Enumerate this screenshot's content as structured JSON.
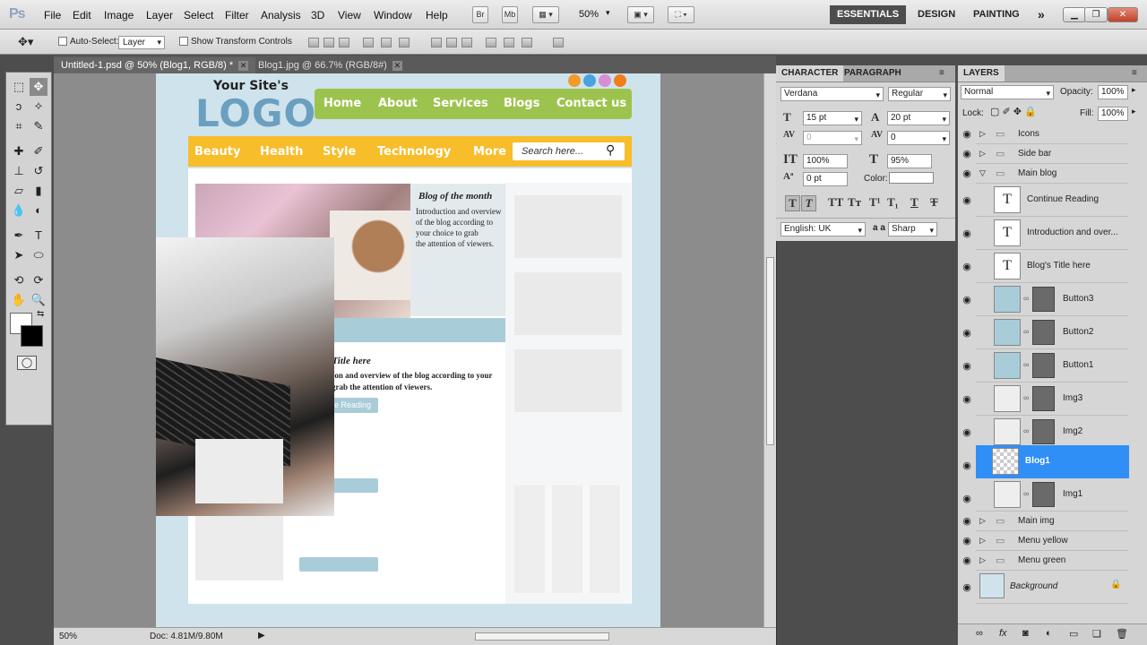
{
  "app": {
    "logo": "Ps"
  },
  "menu": [
    "File",
    "Edit",
    "Image",
    "Layer",
    "Select",
    "Filter",
    "Analysis",
    "3D",
    "View",
    "Window",
    "Help"
  ],
  "top_toolbar": {
    "bridge": "Br",
    "mini_bridge": "Mb",
    "zoom": "50%"
  },
  "workspaces": {
    "essentials": "ESSENTIALS",
    "design": "DESIGN",
    "painting": "PAINTING",
    "more": "»"
  },
  "options": {
    "auto_select": "Auto-Select:",
    "auto_select_value": "Layer",
    "show_transform": "Show Transform Controls"
  },
  "tabs": [
    {
      "label": "Untitled-1.psd @ 50% (Blog1, RGB/8) *"
    },
    {
      "label": "Blog1.jpg @ 66.7% (RGB/8#)"
    }
  ],
  "mockup": {
    "site_title": "Your Site's",
    "logo": "LOGO",
    "nav_green": [
      "Home",
      "About",
      "Services",
      "Blogs",
      "Contact us"
    ],
    "nav_yellow": [
      "Beauty",
      "Health",
      "Style",
      "Technology",
      "More"
    ],
    "search_placeholder": "Search here...",
    "month_title": "Blog of the month",
    "month_text": [
      "Introduction and overview",
      "of the blog according to",
      "your choice to grab",
      "the attention of viewers."
    ],
    "blog_title": "Blog's Title here",
    "blog_text": [
      "Introduction and overview of the blog according to your",
      "choice to grab the attention of viewers."
    ],
    "continue": "Continue Reading"
  },
  "status": {
    "zoom": "50%",
    "doc": "Doc: 4.81M/9.80M"
  },
  "character": {
    "tabs": [
      "CHARACTER",
      "PARAGRAPH"
    ],
    "font_family": "Verdana",
    "font_style": "Regular",
    "size": "15 pt",
    "leading": "20 pt",
    "kerning": "0",
    "tracking": "0",
    "vscale": "100%",
    "hscale": "95%",
    "baseline": "0 pt",
    "color_label": "Color:",
    "language": "English: UK",
    "aa_label": "a a",
    "antialias": "Sharp"
  },
  "layers_panel": {
    "title": "LAYERS",
    "blend": "Normal",
    "opacity_label": "Opacity:",
    "opacity": "100%",
    "lock_label": "Lock:",
    "fill_label": "Fill:",
    "fill": "100%",
    "items": [
      {
        "name": "Icons"
      },
      {
        "name": "Side bar"
      },
      {
        "name": "Main blog"
      },
      {
        "name": "Continue Reading"
      },
      {
        "name": "Introduction and over..."
      },
      {
        "name": "Blog's Title here"
      },
      {
        "name": "Button3"
      },
      {
        "name": "Button2"
      },
      {
        "name": "Button1"
      },
      {
        "name": "Img3"
      },
      {
        "name": "Img2"
      },
      {
        "name": "Blog1"
      },
      {
        "name": "Img1"
      },
      {
        "name": "Main img"
      },
      {
        "name": "Menu yellow"
      },
      {
        "name": "Menu green"
      },
      {
        "name": "Background"
      }
    ]
  },
  "colors": {
    "accent": "#2f8ff7",
    "green_nav": "#9dc34f",
    "yellow_nav": "#f7bd2a",
    "logo_blue": "#6a9fc0"
  }
}
